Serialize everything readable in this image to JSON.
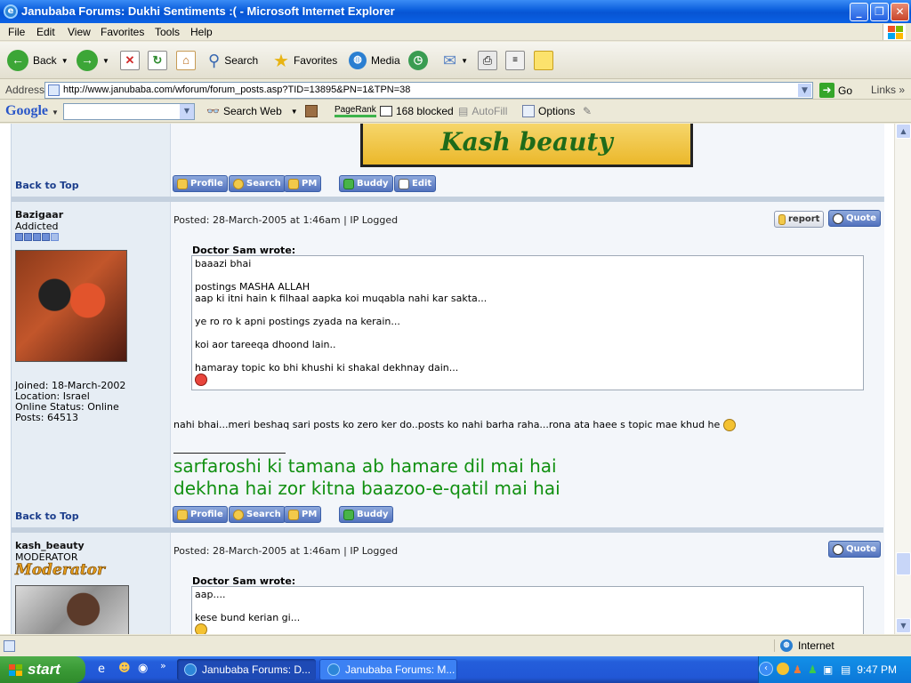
{
  "window": {
    "title": "Janubaba Forums: Dukhi Sentiments :( - Microsoft Internet Explorer"
  },
  "menu": [
    "File",
    "Edit",
    "View",
    "Favorites",
    "Tools",
    "Help"
  ],
  "toolbar": {
    "back": "Back",
    "search": "Search",
    "favorites": "Favorites",
    "media": "Media"
  },
  "address": {
    "label": "Address",
    "url": "http://www.janubaba.com/wforum/forum_posts.asp?TID=13895&PN=1&TPN=38",
    "go": "Go",
    "links": "Links"
  },
  "googlebar": {
    "logo": "Google",
    "search_web": "Search Web",
    "pagerank": "PageRank",
    "blocked": "168 blocked",
    "autofill": "AutoFill",
    "options": "Options"
  },
  "forum": {
    "banner_text": "Kash beauty",
    "back_to_top": "Back to Top",
    "buttons": {
      "profile": "Profile",
      "search": "Search",
      "pm": "PM",
      "buddy": "Buddy",
      "edit": "Edit",
      "report": "report",
      "quote": "Quote"
    },
    "posts": [
      {
        "username": "Bazigaar",
        "rank": "Addicted",
        "rank_stars": 5,
        "joined": "Joined: 18-March-2002",
        "location": "Location: Israel",
        "online": "Online Status: Online",
        "posts": "Posts: 64513",
        "posted": "Posted: 28-March-2005 at 1:46am | IP Logged",
        "quote_author": "Doctor Sam wrote:",
        "quote_lines": [
          "baaazi bhai",
          "",
          "postings MASHA ALLAH",
          "aap ki itni hain k filhaal aapka koi muqabla nahi kar sakta...",
          "",
          "ye ro ro k apni postings zyada na kerain...",
          "",
          "koi aor tareeqa dhoond lain..",
          "",
          "hamaray topic ko bhi khushi ki shakal dekhnay dain..."
        ],
        "body": "nahi bhai...meri beshaq sari posts ko zero ker do..posts ko nahi barha raha...rona ata haee s topic mae khud he",
        "signature": [
          "sarfaroshi ki tamana ab hamare dil mai hai",
          "dekhna hai zor kitna baazoo-e-qatil mai hai"
        ]
      },
      {
        "username": "kash_beauty",
        "rank": "MODERATOR",
        "rank_badge": "Moderator",
        "posted": "Posted: 28-March-2005 at 1:46am | IP Logged",
        "quote_author": "Doctor Sam wrote:",
        "quote_lines": [
          "aap....",
          "",
          "kese bund kerian gi..."
        ]
      }
    ]
  },
  "status": {
    "zone": "Internet"
  },
  "taskbar": {
    "start": "start",
    "tasks": [
      "Janubaba Forums: D...",
      "Janubaba Forums: M..."
    ],
    "clock": "9:47 PM"
  },
  "colors": {
    "signature_green": "#119011",
    "link_blue": "#1C3E8C",
    "forum_bg": "#E6EDF4"
  }
}
